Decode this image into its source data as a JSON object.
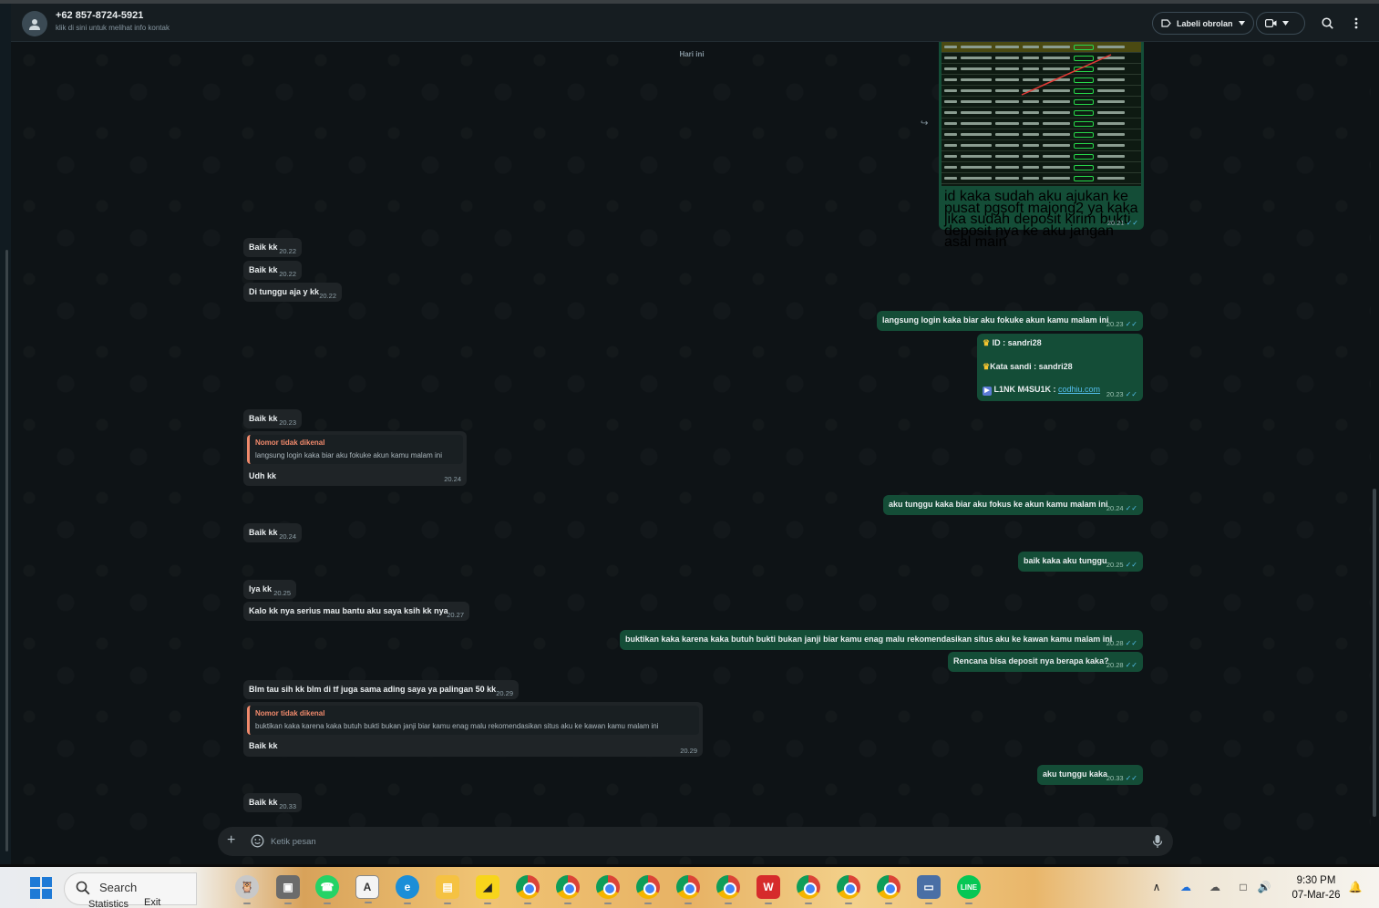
{
  "header": {
    "contact_name": "+62 857-8724-5921",
    "contact_sub": "klik di sini untuk melihat info kontak",
    "label_button": "Labeli obrolan"
  },
  "day_chip": "Hari ini",
  "image_message": {
    "caption": "id kaka sudah aku ajukan ke pusat pgsoft majong2 ya kaka jika sudah deposit kirim bukti deposit nya ke aku jangan asal main",
    "time": "20.21"
  },
  "messages": [
    {
      "text": "Baik kk",
      "time": "20.22"
    },
    {
      "text": "Baik kk",
      "time": "20.22"
    },
    {
      "text": "Di tunggu aja y kk",
      "time": "20.22"
    },
    {
      "text": "langsung login kaka biar aku fokuke akun kamu malam ini",
      "time": "20.23"
    },
    {
      "id_line": "ID :  sandri28",
      "pass_line": "Kata sandi : sandri28",
      "link_label": "L1NK M4SU1K : ",
      "link": "codhiu.com",
      "time": "20.23"
    },
    {
      "text": "Baik kk",
      "time": "20.23"
    },
    {
      "quote_name": "Nomor tidak dikenal",
      "quote_text": "langsung login kaka biar aku fokuke akun kamu malam ini",
      "text": "Udh kk",
      "time": "20.24"
    },
    {
      "text": "aku tunggu kaka biar aku fokus ke akun kamu malam ini",
      "time": "20.24"
    },
    {
      "text": "Baik kk",
      "time": "20.24"
    },
    {
      "text": "baik kaka aku tunggu",
      "time": "20.25"
    },
    {
      "text": "Iya kk",
      "time": "20.25"
    },
    {
      "text": "Kalo kk nya serius mau bantu aku saya ksih kk nya",
      "time": "20.27"
    },
    {
      "text": "buktikan kaka karena kaka butuh bukti bukan janji biar kamu enag malu rekomendasikan situs aku ke kawan kamu malam ini",
      "time": "20.28"
    },
    {
      "text": "Rencana bisa deposit nya berapa kaka?",
      "time": "20.28"
    },
    {
      "text": "Blm tau sih kk blm di tf juga sama ading saya ya palingan 50 kk",
      "time": "20.29"
    },
    {
      "quote_name": "Nomor tidak dikenal",
      "quote_text": "buktikan kaka karena kaka butuh bukti bukan janji biar kamu enag malu rekomendasikan situs aku ke kawan kamu malam ini",
      "text": "Baik kk",
      "time": "20.29"
    },
    {
      "text": "aku tunggu kaka",
      "time": "20.33"
    },
    {
      "text": "Baik kk",
      "time": "20.33"
    }
  ],
  "composer": {
    "placeholder": "Ketik pesan"
  },
  "taskbar": {
    "search_label": "Search",
    "statistics_label": "Statistics",
    "exit_label": "Exit",
    "time": "9:30 PM",
    "date": "07-Mar-26"
  },
  "colors": {
    "outgoing": "#144d37",
    "incoming": "#1f2427",
    "accent": "#53bdeb"
  }
}
